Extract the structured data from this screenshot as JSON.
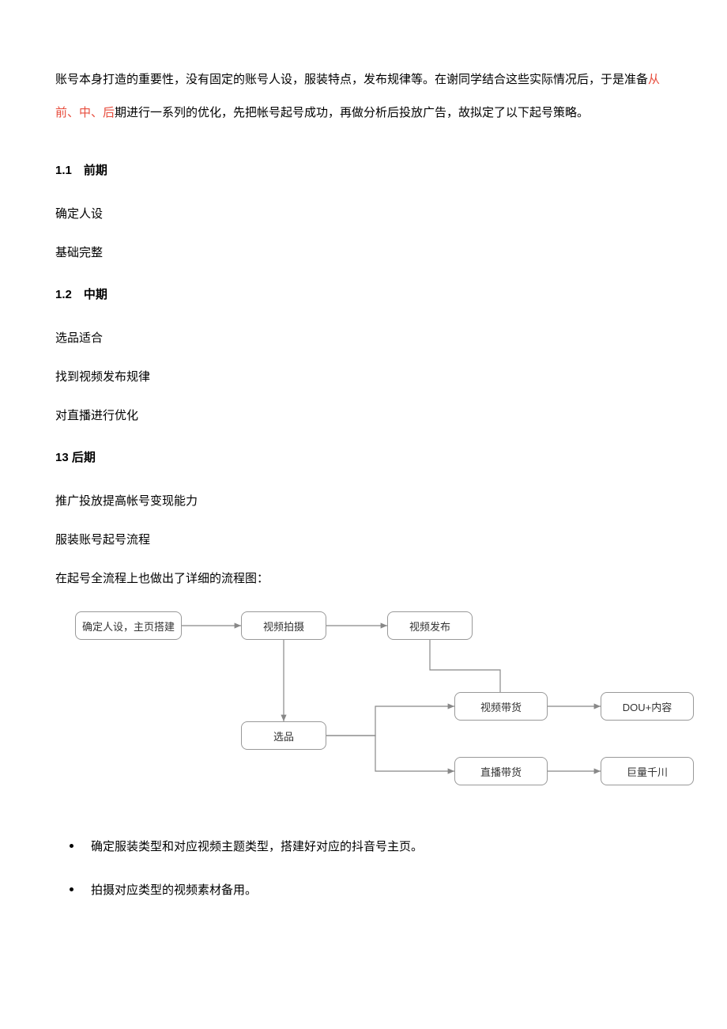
{
  "intro": {
    "part1": "账号本身打造的重要性，没有固定的账号人设，服装特点，发布规律等。在谢同学结合这些实际情况后，于是准备",
    "red": "从前、中、后",
    "part2": "期进行一系列的优化，先把帐号起号成功，再做分析后投放广告，故拟定了以下起号策略。"
  },
  "sections": {
    "s1": {
      "heading": "1.1　前期",
      "items": [
        "确定人设",
        "基础完整"
      ]
    },
    "s2": {
      "heading": "1.2　中期",
      "items": [
        "选品适合",
        "找到视频发布规律",
        "对直播进行优化"
      ]
    },
    "s3": {
      "heading": "13 后期",
      "items": [
        "推广投放提高帐号变现能力",
        "服装账号起号流程",
        "在起号全流程上也做出了详细的流程图："
      ]
    }
  },
  "chart_data": {
    "type": "diagram",
    "title": "服装账号起号流程",
    "nodes": [
      {
        "id": "n1",
        "label": "确定人设，主页搭建"
      },
      {
        "id": "n2",
        "label": "视频拍摄"
      },
      {
        "id": "n3",
        "label": "视频发布"
      },
      {
        "id": "n4",
        "label": "选品"
      },
      {
        "id": "n5",
        "label": "视频带货"
      },
      {
        "id": "n6",
        "label": "直播带货"
      },
      {
        "id": "n7",
        "label": "DOU+内容"
      },
      {
        "id": "n8",
        "label": "巨量千川"
      }
    ],
    "edges": [
      [
        "n1",
        "n2"
      ],
      [
        "n2",
        "n3"
      ],
      [
        "n2",
        "n4"
      ],
      [
        "n4",
        "n5"
      ],
      [
        "n4",
        "n6"
      ],
      [
        "n5",
        "n7"
      ],
      [
        "n6",
        "n8"
      ]
    ]
  },
  "bullets": {
    "b1": "确定服装类型和对应视频主题类型，搭建好对应的抖音号主页。",
    "b2": "拍摄对应类型的视频素材备用。"
  }
}
